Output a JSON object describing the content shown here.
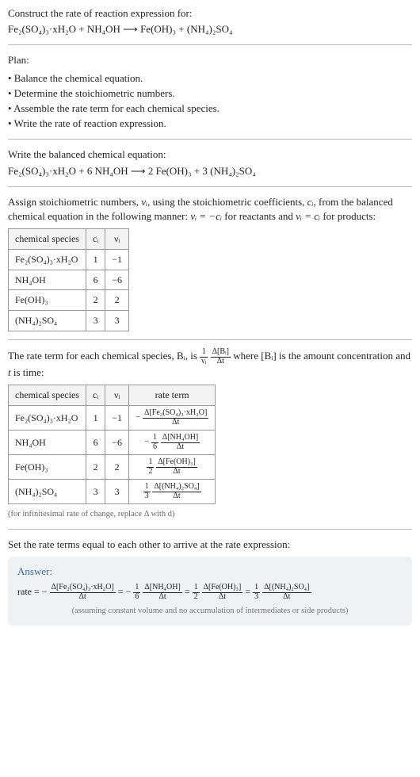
{
  "title": "Construct the rate of reaction expression for:",
  "unbalanced_equation": "Fe₂(SO₄)₃·xH₂O + NH₄OH  ⟶  Fe(OH)₃ + (NH₄)₂SO₄",
  "plan_title": "Plan:",
  "plan_items": [
    "• Balance the chemical equation.",
    "• Determine the stoichiometric numbers.",
    "• Assemble the rate term for each chemical species.",
    "• Write the rate of reaction expression."
  ],
  "balanced_title": "Write the balanced chemical equation:",
  "balanced_equation": "Fe₂(SO₄)₃·xH₂O + 6 NH₄OH  ⟶  2 Fe(OH)₃ + 3 (NH₄)₂SO₄",
  "stoich_text_a": "Assign stoichiometric numbers, ",
  "stoich_text_b": ", using the stoichiometric coefficients, ",
  "stoich_text_c": ", from the balanced chemical equation in the following manner: ",
  "stoich_text_d": " for reactants and ",
  "stoich_text_e": " for products:",
  "nu_i": "νᵢ",
  "c_i": "cᵢ",
  "nu_eq_neg_c": "νᵢ = −cᵢ",
  "nu_eq_c": "νᵢ = cᵢ",
  "table1": {
    "headers": [
      "chemical species",
      "cᵢ",
      "νᵢ"
    ],
    "rows": [
      [
        "Fe₂(SO₄)₃·xH₂O",
        "1",
        "−1"
      ],
      [
        "NH₄OH",
        "6",
        "−6"
      ],
      [
        "Fe(OH)₃",
        "2",
        "2"
      ],
      [
        "(NH₄)₂SO₄",
        "3",
        "3"
      ]
    ]
  },
  "rate_term_text_a": "The rate term for each chemical species, Bᵢ, is ",
  "rate_term_frac_left_num": "1",
  "rate_term_frac_left_den": "νᵢ",
  "rate_term_frac_right_num": "Δ[Bᵢ]",
  "rate_term_frac_right_den": "Δt",
  "rate_term_text_b": " where [Bᵢ] is the amount concentration and ",
  "rate_term_text_c": " is time:",
  "t_sym": "t",
  "table2": {
    "headers": [
      "chemical species",
      "cᵢ",
      "νᵢ",
      "rate term"
    ],
    "rows": [
      {
        "sp": "Fe₂(SO₄)₃·xH₂O",
        "c": "1",
        "nu": "−1",
        "pre": "−",
        "coef_num": "",
        "coef_den": "",
        "num": "Δ[Fe₂(SO₄)₃·xH₂O]",
        "den": "Δt"
      },
      {
        "sp": "NH₄OH",
        "c": "6",
        "nu": "−6",
        "pre": "−",
        "coef_num": "1",
        "coef_den": "6",
        "num": "Δ[NH₄OH]",
        "den": "Δt"
      },
      {
        "sp": "Fe(OH)₃",
        "c": "2",
        "nu": "2",
        "pre": "",
        "coef_num": "1",
        "coef_den": "2",
        "num": "Δ[Fe(OH)₃]",
        "den": "Δt"
      },
      {
        "sp": "(NH₄)₂SO₄",
        "c": "3",
        "nu": "3",
        "pre": "",
        "coef_num": "1",
        "coef_den": "3",
        "num": "Δ[(NH₄)₂SO₄]",
        "den": "Δt"
      }
    ]
  },
  "infinitesimal_note": "(for infinitesimal rate of change, replace Δ with d)",
  "set_equal_text": "Set the rate terms equal to each other to arrive at the rate expression:",
  "answer_label": "Answer:",
  "rate_eq": {
    "prefix": "rate = ",
    "terms": [
      {
        "pre": "−",
        "coef_num": "",
        "coef_den": "",
        "num": "Δ[Fe₂(SO₄)₃·xH₂O]",
        "den": "Δt"
      },
      {
        "pre": "= −",
        "coef_num": "1",
        "coef_den": "6",
        "num": "Δ[NH₄OH]",
        "den": "Δt"
      },
      {
        "pre": "= ",
        "coef_num": "1",
        "coef_den": "2",
        "num": "Δ[Fe(OH)₃]",
        "den": "Δt"
      },
      {
        "pre": "= ",
        "coef_num": "1",
        "coef_den": "3",
        "num": "Δ[(NH₄)₂SO₄]",
        "den": "Δt"
      }
    ]
  },
  "assumption_note": "(assuming constant volume and no accumulation of intermediates or side products)"
}
